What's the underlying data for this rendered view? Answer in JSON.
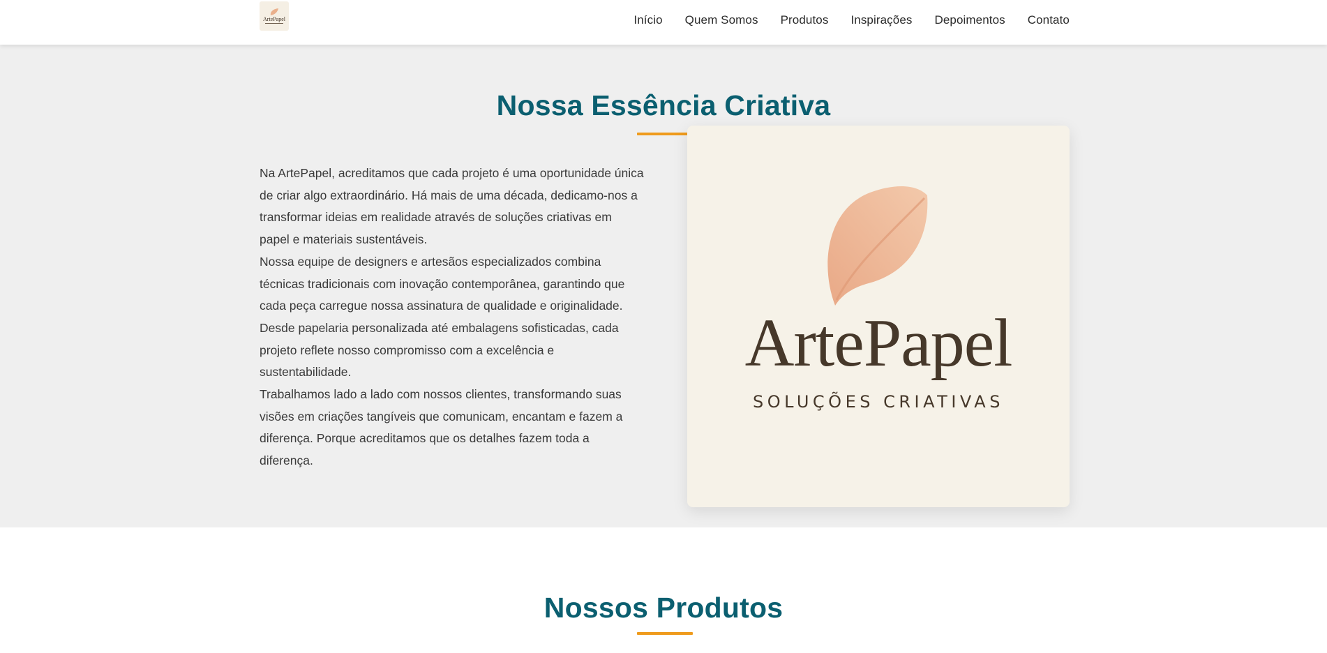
{
  "header": {
    "logo": {
      "word": "ArtePapel",
      "icon": "leaf-icon"
    },
    "nav": [
      "Início",
      "Quem Somos",
      "Produtos",
      "Inspirações",
      "Depoimentos",
      "Contato"
    ]
  },
  "about": {
    "title": "Nossa Essência Criativa",
    "paragraphs": [
      "Na ArtePapel, acreditamos que cada projeto é uma oportunidade única de criar algo extraordinário. Há mais de uma década, dedicamo-nos a transformar ideias em realidade através de soluções criativas em papel e materiais sustentáveis.",
      "Nossa equipe de designers e artesãos especializados combina técnicas tradicionais com inovação contemporânea, garantindo que cada peça carregue nossa assinatura de qualidade e originalidade.",
      "Desde papelaria personalizada até embalagens sofisticadas, cada projeto reflete nosso compromisso com a excelência e sustentabilidade.",
      "Trabalhamos lado a lado com nossos clientes, transformando suas visões em criações tangíveis que comunicam, encantam e fazem a diferença. Porque acreditamos que os detalhes fazem toda a diferença."
    ],
    "image": {
      "brand": "ArtePapel",
      "tagline": "SOLUÇÕES CRIATIVAS",
      "icon": "leaf-icon"
    }
  },
  "products": {
    "title": "Nossos Produtos"
  },
  "colors": {
    "accent": "#ef9b1c",
    "heading": "#0b5f70",
    "brand_text": "#46382a",
    "leaf": "#eab08c"
  }
}
